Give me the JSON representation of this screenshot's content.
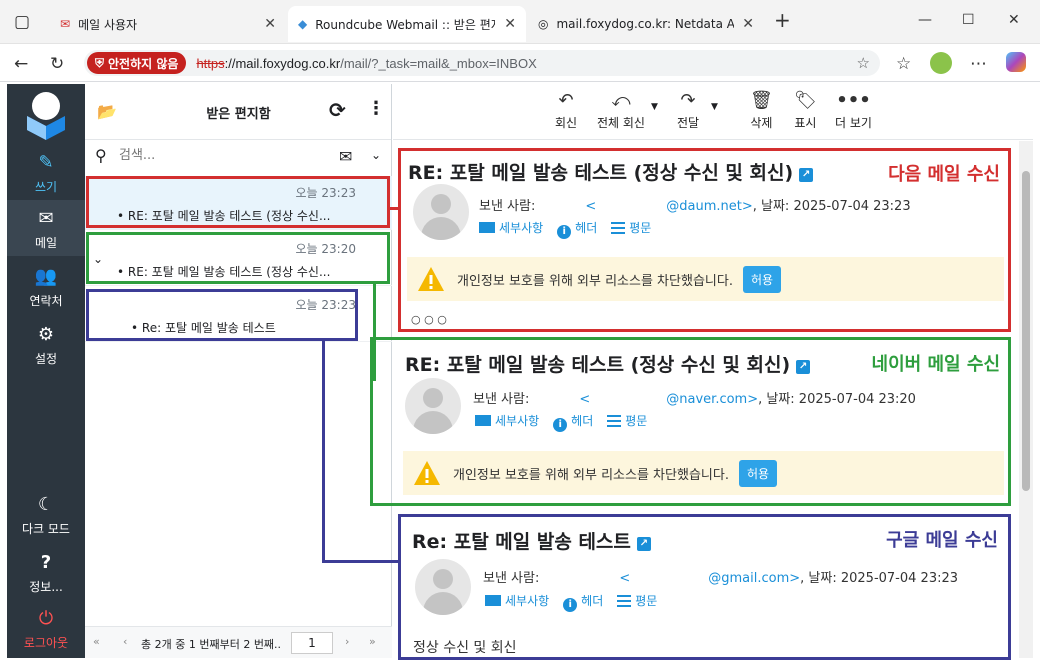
{
  "browser": {
    "tabs": [
      {
        "label": "메일 사용자"
      },
      {
        "label": "Roundcube Webmail :: 받은 편지함"
      },
      {
        "label": "mail.foxydog.co.kr: Netdata Agent"
      }
    ],
    "security_label": "안전하지 않음",
    "url_proto": "https",
    "url_host": "://mail.foxydog.co.kr",
    "url_path": "/mail/?_task=mail&_mbox=INBOX"
  },
  "nav": {
    "items": [
      {
        "label": "쓰기"
      },
      {
        "label": "메일"
      },
      {
        "label": "연락처"
      },
      {
        "label": "설정"
      },
      {
        "label": "다크 모드"
      },
      {
        "label": "정보..."
      },
      {
        "label": "로그아웃"
      }
    ]
  },
  "list": {
    "title": "받은 편지함",
    "search_placeholder": "검색...",
    "messages": [
      {
        "date": "오늘 23:23",
        "subject": "RE: 포탈 메일 발송 테스트 (정상 수신..."
      },
      {
        "date": "오늘 23:20",
        "subject": "RE: 포탈 메일 발송 테스트 (정상 수신..."
      },
      {
        "date": "오늘 23:23",
        "subject": "Re: 포탈 메일 발송 테스트"
      }
    ],
    "pager_text": "총 2개 중 1 번째부터 2 번째...",
    "page": "1"
  },
  "toolbar": {
    "reply": "회신",
    "reply_all": "전체 회신",
    "forward": "전달",
    "delete": "삭제",
    "mark": "표시",
    "more": "더 보기"
  },
  "messages": [
    {
      "subject": "RE: 포탈 메일 발송 테스트 (정상 수신 및 회신)",
      "tag": "다음 메일 수신",
      "tag_color": "#d32f2f",
      "from_label": "보낸 사람:",
      "from_lt": "<",
      "from_addr": "@daum.net>",
      "date_text": ", 날짜: 2025-07-04 23:23",
      "notice": "개인정보 보호를 위해 외부 리소스를 차단했습니다.",
      "allow": "허용",
      "extra": "○ ○ ○"
    },
    {
      "subject": "RE: 포탈 메일 발송 테스트 (정상 수신 및 회신)",
      "tag": "네이버 메일 수신",
      "tag_color": "#2e9e3e",
      "from_label": "보낸 사람:",
      "from_lt": "<",
      "from_addr": "@naver.com>",
      "date_text": ", 날짜: 2025-07-04 23:20",
      "notice": "개인정보 보호를 위해 외부 리소스를 차단했습니다.",
      "allow": "허용"
    },
    {
      "subject": "Re: 포탈 메일 발송 테스트",
      "tag": "구글 메일 수신",
      "tag_color": "#3c3c96",
      "from_label": "보낸 사람:",
      "from_lt": "<",
      "from_addr": "@gmail.com>",
      "date_text": ", 날짜: 2025-07-04 23:23",
      "body": "정상 수신 및 회신"
    }
  ],
  "header_links": {
    "details": "세부사항",
    "headers": "헤더",
    "plain": "평문"
  },
  "colors": {
    "red": "#d32f2f",
    "green": "#2e9e3e",
    "blue": "#3c3c96",
    "accent": "#1a8fd8"
  }
}
